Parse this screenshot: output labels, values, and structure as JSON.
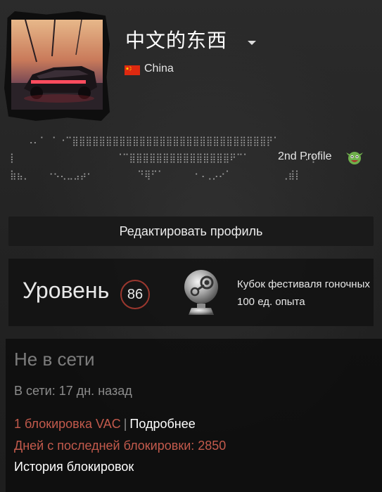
{
  "profile": {
    "name": "中文的东西",
    "country": "China"
  },
  "summary": {
    "ascii_lines": [
      "   ⠠⠄⠁ ⠁⠐⠉⣿⣿⣿⣿⣿⣿⣿⣿⣿⣿⣿⣿⣿⣿⣿⣿⣿⣿⣿⣿⣿⣿⣿⣿⣿⣿⣿⣿⣿⡟⠁",
      "⡇                  ⠈⠉⣿⣿⣿⣿⣿⣿⣿⣿⣿⣿⣿⣿⣿⣿⣿⠟⠉⠁          ⠄⡇",
      "⣷⣦⡀   ⠐⠢⢄⣀⣠⡴⠂        ⠙⢿⠋⠁     ⠐⠠⢀⡠⠔⠁         ⢀⣾⡇"
    ],
    "trailing_text": "2nd Profile"
  },
  "buttons": {
    "edit_profile": "Редактировать профиль"
  },
  "level": {
    "label": "Уровень",
    "value": "86",
    "badge_name": "Кубок фестиваля гоночных",
    "badge_xp": "100 ед. опыта"
  },
  "status": {
    "title": "Не в сети",
    "last_online": "В сети: 17 дн. назад",
    "vac_count": "1 блокировка VAC",
    "vac_separator": "|",
    "vac_info": "Подробнее",
    "days_since_ban": "Дней с последней блокировки: 2850",
    "ban_history": "История блокировок"
  },
  "colors": {
    "background": "#262626",
    "ban_red": "#c35a4c",
    "level_ring": "#9b372e"
  },
  "icons": {
    "flag": "china-flag-icon",
    "dropdown": "chevron-down-icon",
    "emoji": "goblin-emoticon-icon",
    "badge": "steam-trophy-badge-icon"
  }
}
